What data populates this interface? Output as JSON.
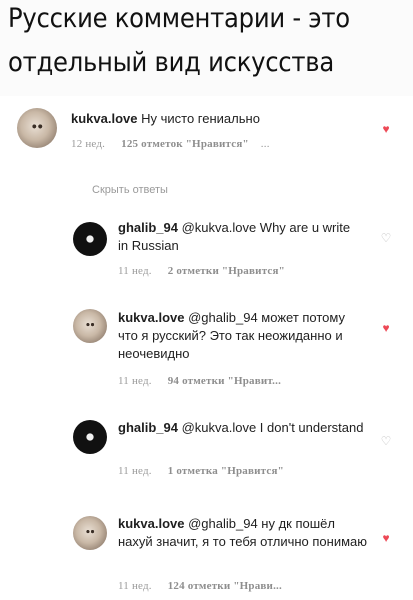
{
  "caption": {
    "line1": "Русские комментарии - это",
    "line2": "отдельный вид искусства"
  },
  "comments": [
    {
      "user": "kukva.love",
      "text": " Ну чисто гениально",
      "time": "12 нед.",
      "likes": "125 отметок \"Нравится\"",
      "more": "...",
      "liked": true
    },
    {
      "user": "ghalib_94",
      "text": " @kukva.love Why are u write in Russian",
      "time": "11 нед.",
      "likes": "2 отметки \"Нравится\"",
      "liked": false
    },
    {
      "user": "kukva.love",
      "text": " @ghalib_94 может потому что я русский? Это так неожиданно и неочевидно",
      "time": "11 нед.",
      "likes": "94 отметки \"Нравит...",
      "liked": true
    },
    {
      "user": "ghalib_94",
      "text": " @kukva.love I don't understand",
      "time": "11 нед.",
      "likes": "1 отметка \"Нравится\"",
      "liked": false
    },
    {
      "user": "kukva.love",
      "text": " @ghalib_94 ну дк пошёл нахуй значит, я то тебя отлично понимаю",
      "time": "11 нед.",
      "likes": "124 отметки \"Нрави...",
      "liked": true
    }
  ],
  "hide_replies": "Скрыть ответы",
  "icons": {
    "heart_filled": "heart-filled-icon",
    "heart_outline": "heart-outline-icon",
    "heart_color": "#ed4956"
  }
}
